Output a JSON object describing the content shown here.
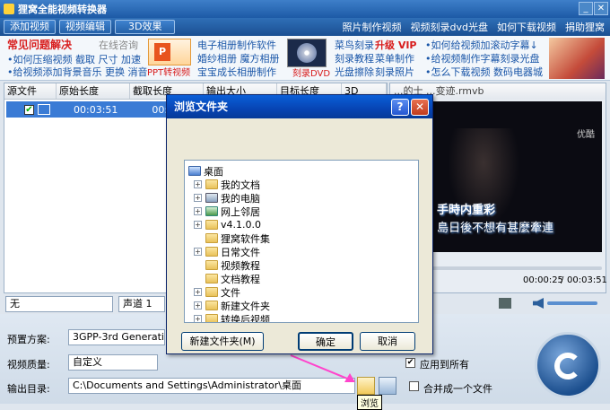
{
  "app": {
    "title": "狸窝全能视频转换器"
  },
  "toolbar": {
    "add_video": "添加视频",
    "edit_video": "视频编辑",
    "effect_3d": "3D效果"
  },
  "top_links": [
    "照片制作视频",
    "视频刻录dvd光盘",
    "如何下载视频",
    "捐助狸窝"
  ],
  "ad": {
    "faq_title": "常见问题解决",
    "online_consult": "在线咨询",
    "faq_line1": "•如何压缩视频  截取  尺寸  加速",
    "faq_line2": "•给视频添加背景音乐  更换  消音",
    "ppt_label": "PPT转视频",
    "mid_links": [
      "电子相册制作软件",
      "婚纱相册  魔方相册",
      "宝宝成长相册制作"
    ],
    "dvd_label": "刻录DVD",
    "burn_links": [
      "菜鸟刻录",
      "刻录教程",
      "光盘擦除"
    ],
    "vip": "升级 VIP",
    "menu_make": "菜单制作",
    "burn_photo": "刻录照片",
    "right_links": [
      "•如何给视频加滚动字幕↓",
      "•给视频制作字幕刻录光盘",
      "•怎么下载视频    数码电器城"
    ]
  },
  "list": {
    "columns": [
      "源文件",
      "原始长度",
      "截取长度",
      "输出大小",
      "目标长度",
      "3D"
    ],
    "row": {
      "duration": "00:03:51",
      "cut": "00:03:5"
    }
  },
  "preview": {
    "filename": "...的士 ...变迹.rmvb",
    "time_current": "00:00:25",
    "time_total": "00:03:51",
    "caption1": "手時内重彩",
    "caption2": "島日後不想有甚麼牽連",
    "watermark": "优酷"
  },
  "subtitle": {
    "value": "无",
    "audio": "声道 1"
  },
  "settings": {
    "preset_label": "预置方案:",
    "preset_value": "3GPP-3rd Generation",
    "quality_label": "视频质量:",
    "quality_value": "自定义",
    "output_label": "输出目录:",
    "output_value": "C:\\Documents and Settings\\Administrator\\桌面",
    "apply_all": "应用到所有",
    "merge": "合并成一个文件",
    "browse_tip": "浏览"
  },
  "dialog": {
    "title": "浏览文件夹",
    "help": "?",
    "close": "✕",
    "tree": [
      {
        "label": "桌面",
        "level": 0,
        "exp": false,
        "icon": "desktop"
      },
      {
        "label": "我的文档",
        "level": 1,
        "exp": true,
        "icon": "doc"
      },
      {
        "label": "我的电脑",
        "level": 1,
        "exp": true,
        "icon": "pc"
      },
      {
        "label": "网上邻居",
        "level": 1,
        "exp": true,
        "icon": "net"
      },
      {
        "label": "v4.1.0.0",
        "level": 1,
        "exp": true,
        "icon": "folder"
      },
      {
        "label": "狸窝软件集",
        "level": 1,
        "exp": false,
        "icon": "folder"
      },
      {
        "label": "日常文件",
        "level": 1,
        "exp": true,
        "icon": "folder"
      },
      {
        "label": "视频教程",
        "level": 1,
        "exp": false,
        "icon": "folder"
      },
      {
        "label": "文档教程",
        "level": 1,
        "exp": false,
        "icon": "folder"
      },
      {
        "label": "文件",
        "level": 1,
        "exp": true,
        "icon": "folder"
      },
      {
        "label": "新建文件夹",
        "level": 1,
        "exp": true,
        "icon": "folder"
      },
      {
        "label": "转换后视频",
        "level": 1,
        "exp": true,
        "icon": "folder"
      }
    ],
    "new_folder": "新建文件夹(M)",
    "ok": "确定",
    "cancel": "取消"
  },
  "colors": {
    "accent": "#1d5aa6",
    "dialog_title": "#0a5fd8",
    "highlight": "#3a7bd5",
    "arrow": "#ff44cc"
  }
}
